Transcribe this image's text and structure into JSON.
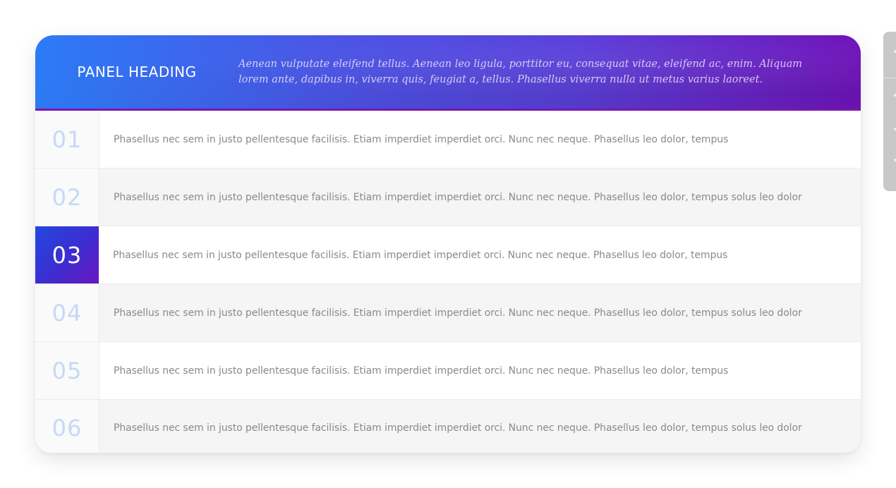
{
  "panel": {
    "heading": "PANEL HEADING",
    "description": "Aenean vulputate eleifend tellus. Aenean leo ligula, porttitor eu, consequat vitae, eleifend ac, enim. Aliquam lorem ante, dapibus in, viverra quis, feugiat a, tellus. Phasellus viverra nulla ut metus varius laoreet."
  },
  "rows": [
    {
      "number": "01",
      "text": "Phasellus nec sem in justo pellentesque facilisis. Etiam imperdiet imperdiet orci. Nunc nec neque. Phasellus leo dolor, tempus"
    },
    {
      "number": "02",
      "text": "Phasellus nec sem in justo pellentesque facilisis. Etiam imperdiet imperdiet orci. Nunc nec neque. Phasellus leo dolor, tempus solus leo dolor"
    },
    {
      "number": "03",
      "text": "Phasellus nec sem in justo pellentesque facilisis. Etiam imperdiet imperdiet orci. Nunc nec neque. Phasellus leo dolor, tempus",
      "active": true
    },
    {
      "number": "04",
      "text": "Phasellus nec sem in justo pellentesque facilisis. Etiam imperdiet imperdiet orci. Nunc nec neque. Phasellus leo dolor, tempus solus leo dolor"
    },
    {
      "number": "05",
      "text": "Phasellus nec sem in justo pellentesque facilisis. Etiam imperdiet imperdiet orci. Nunc nec neque. Phasellus leo dolor, tempus"
    },
    {
      "number": "06",
      "text": "Phasellus nec sem in justo pellentesque facilisis. Etiam imperdiet imperdiet orci. Nunc nec neque. Phasellus leo dolor, tempus solus leo dolor"
    }
  ],
  "colors": {
    "header_gradient_start": "#2c7bf6",
    "header_gradient_end": "#6f13b9",
    "number_inactive": "#c5d8f7",
    "body_text": "#8a8a8a"
  }
}
